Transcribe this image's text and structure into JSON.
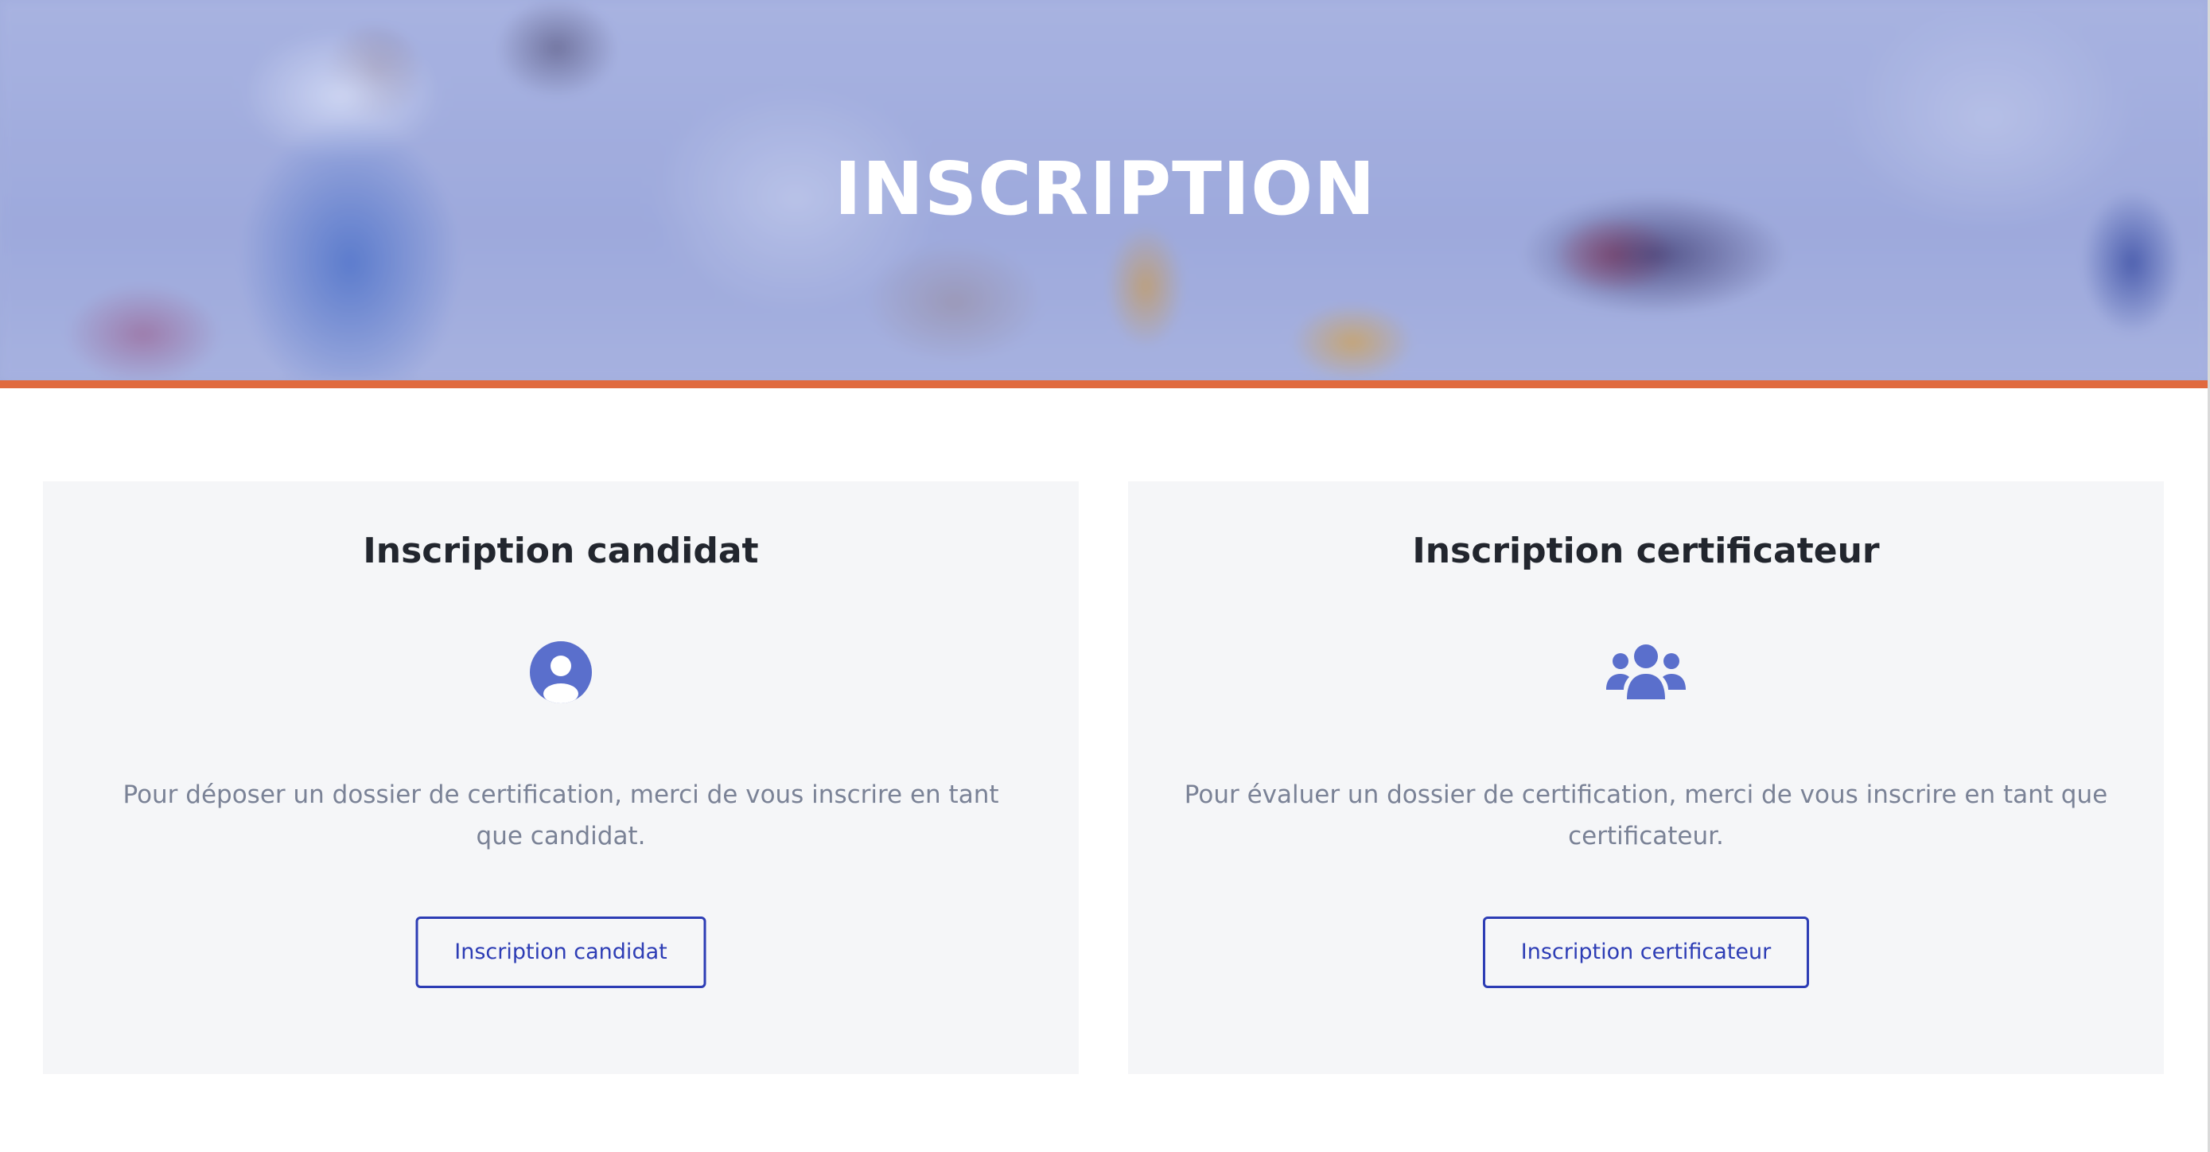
{
  "hero": {
    "title": "INSCRIPTION"
  },
  "colors": {
    "accent_bar": "#e06a3f",
    "brand_blue": "#2d3db5",
    "icon_blue": "#5a6fcc"
  },
  "cards": [
    {
      "title": "Inscription candidat",
      "icon": "user-circle-icon",
      "description": "Pour déposer un dossier de certification, merci de vous inscrire en tant que candidat.",
      "button_label": "Inscription candidat"
    },
    {
      "title": "Inscription certificateur",
      "icon": "users-group-icon",
      "description": "Pour évaluer un dossier de certification, merci de vous inscrire en tant que certificateur.",
      "button_label": "Inscription certificateur"
    }
  ]
}
